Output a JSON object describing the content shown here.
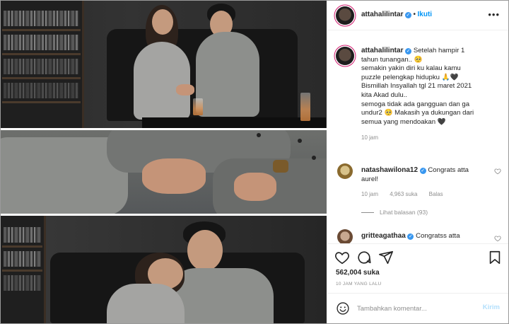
{
  "post": {
    "author": "attahalilintar",
    "follow_label": "Ikuti",
    "separator": "•",
    "more_glyph": "•••"
  },
  "caption": {
    "username": "attahalilintar",
    "lines": [
      "Setelah hampir 1",
      "tahun tunangan.. 🥺",
      "semakin yakin diri ku kalau kamu",
      "puzzle pelengkap hidupku 🙏🖤",
      "Bismillah Insyallah tgl 21 maret 2021",
      "kita Akad dulu..",
      "semoga tidak ada gangguan dan ga",
      "undur2 🥺 Makasih ya dukungan dari",
      "semua yang mendoakan 🖤"
    ],
    "time": "10 jam"
  },
  "comments": [
    {
      "username": "natashawilona12",
      "text_line1": "Congrats atta",
      "text_line2": "aurel!",
      "time": "10 jam",
      "likes": "4,963 suka",
      "reply_label": "Balas",
      "view_replies": "Lihat balasan (93)"
    },
    {
      "username": "gritteagathaa",
      "text_line1": "Congratss atta"
    }
  ],
  "actions": {
    "likes_count": "562,004 suka",
    "time_ago": "10 JAM YANG LALU"
  },
  "composer": {
    "placeholder": "Tambahkan komentar...",
    "post_label": "Kirim"
  },
  "colors": {
    "accent": "#0095f6",
    "verified": "#3897f0",
    "story_ring": "#d11a6f",
    "post_disabled": "#b2dffc"
  },
  "icons": [
    "verified-badge-icon",
    "more-options-icon",
    "heart-icon",
    "comment-icon",
    "share-icon",
    "bookmark-icon",
    "emoji-icon",
    "small-heart-icon"
  ]
}
